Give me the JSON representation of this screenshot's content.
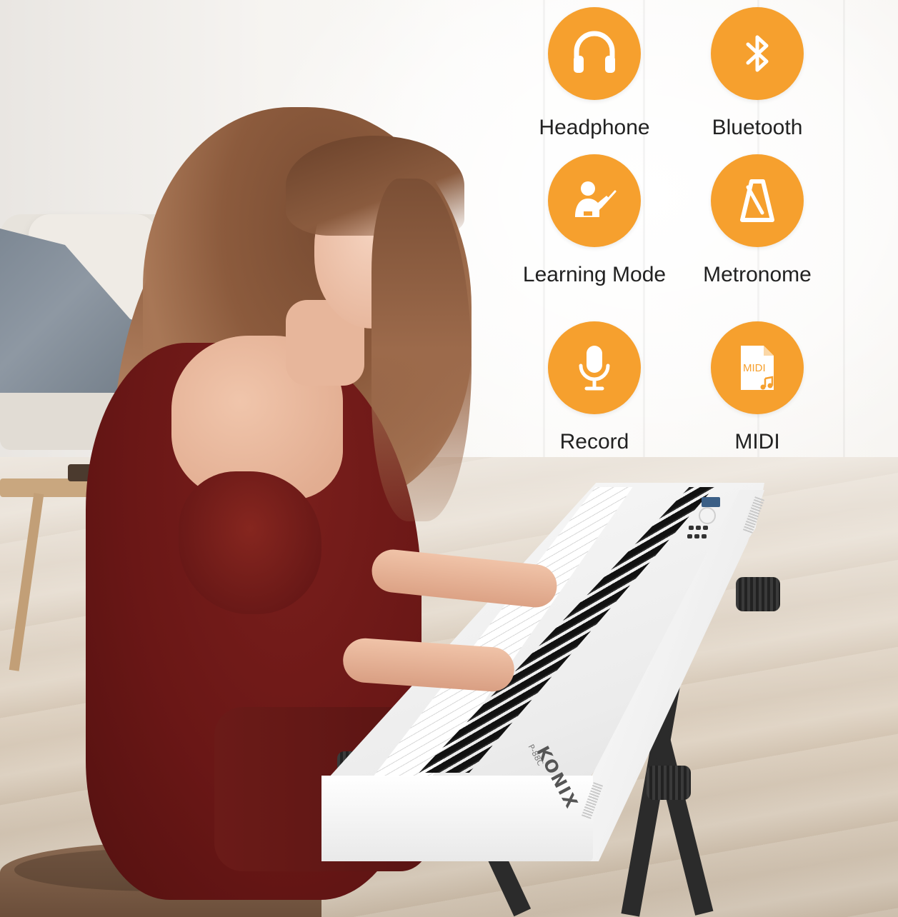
{
  "features": [
    {
      "label": "Headphone",
      "icon": "headphone-icon"
    },
    {
      "label": "Bluetooth",
      "icon": "bluetooth-icon"
    },
    {
      "label": "Learning Mode",
      "icon": "teacher-icon"
    },
    {
      "label": "Metronome",
      "icon": "metronome-icon"
    },
    {
      "label": "Record",
      "icon": "microphone-icon"
    },
    {
      "label": "MIDI",
      "icon": "midi-file-icon"
    }
  ],
  "product": {
    "brand": "KONIX",
    "model": "P-88C"
  },
  "colors": {
    "icon_accent": "#f6a02e",
    "label_text": "#222222"
  }
}
